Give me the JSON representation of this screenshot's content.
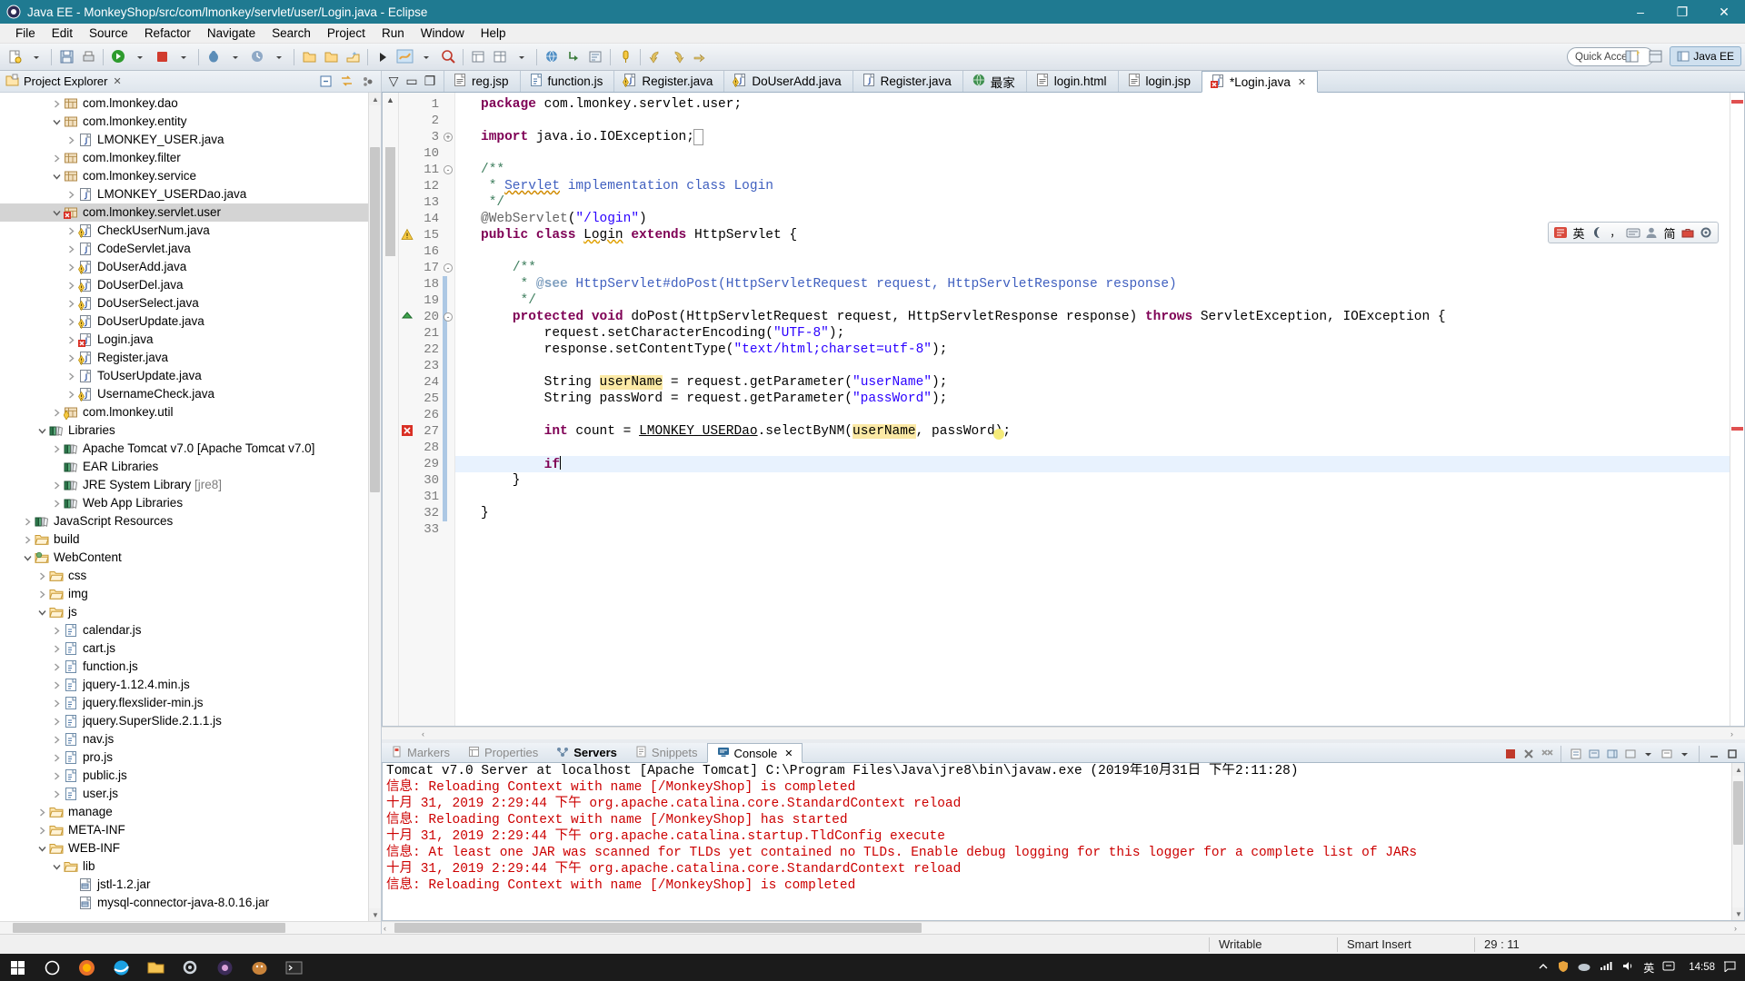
{
  "window": {
    "title": "Java EE - MonkeyShop/src/com/lmonkey/servlet/user/Login.java - Eclipse",
    "icon": "eclipse-icon",
    "minimize": "–",
    "maximize": "❐",
    "close": "✕"
  },
  "menubar": {
    "items": [
      "File",
      "Edit",
      "Source",
      "Refactor",
      "Navigate",
      "Search",
      "Project",
      "Run",
      "Window",
      "Help"
    ]
  },
  "toolbar": {
    "quick_access_placeholder": "Quick Access",
    "perspective_java_ee": "Java EE"
  },
  "explorer": {
    "title": "Project Explorer",
    "close_glyph": "✕",
    "tree": [
      {
        "depth": 3,
        "arrow": "collapsed",
        "icon": "package-icon",
        "label": "com.lmonkey.dao"
      },
      {
        "depth": 3,
        "arrow": "expanded",
        "icon": "package-icon",
        "label": "com.lmonkey.entity"
      },
      {
        "depth": 4,
        "arrow": "collapsed",
        "icon": "java-file-icon",
        "label": "LMONKEY_USER.java"
      },
      {
        "depth": 3,
        "arrow": "collapsed",
        "icon": "package-icon",
        "label": "com.lmonkey.filter"
      },
      {
        "depth": 3,
        "arrow": "expanded",
        "icon": "package-icon",
        "label": "com.lmonkey.service"
      },
      {
        "depth": 4,
        "arrow": "collapsed",
        "icon": "java-file-icon",
        "label": "LMONKEY_USERDao.java"
      },
      {
        "depth": 3,
        "arrow": "expanded",
        "icon": "package-error-icon",
        "label": "com.lmonkey.servlet.user",
        "selected": true
      },
      {
        "depth": 4,
        "arrow": "collapsed",
        "icon": "java-warn-icon",
        "label": "CheckUserNum.java"
      },
      {
        "depth": 4,
        "arrow": "collapsed",
        "icon": "java-file-icon",
        "label": "CodeServlet.java"
      },
      {
        "depth": 4,
        "arrow": "collapsed",
        "icon": "java-warn-icon",
        "label": "DoUserAdd.java"
      },
      {
        "depth": 4,
        "arrow": "collapsed",
        "icon": "java-warn-icon",
        "label": "DoUserDel.java"
      },
      {
        "depth": 4,
        "arrow": "collapsed",
        "icon": "java-warn-icon",
        "label": "DoUserSelect.java"
      },
      {
        "depth": 4,
        "arrow": "collapsed",
        "icon": "java-warn-icon",
        "label": "DoUserUpdate.java"
      },
      {
        "depth": 4,
        "arrow": "collapsed",
        "icon": "java-error-icon",
        "label": "Login.java"
      },
      {
        "depth": 4,
        "arrow": "collapsed",
        "icon": "java-warn-icon",
        "label": "Register.java"
      },
      {
        "depth": 4,
        "arrow": "collapsed",
        "icon": "java-file-icon",
        "label": "ToUserUpdate.java"
      },
      {
        "depth": 4,
        "arrow": "collapsed",
        "icon": "java-warn-icon",
        "label": "UsernameCheck.java"
      },
      {
        "depth": 3,
        "arrow": "collapsed",
        "icon": "package-warn-icon",
        "label": "com.lmonkey.util"
      },
      {
        "depth": 2,
        "arrow": "expanded",
        "icon": "library-icon",
        "label": "Libraries"
      },
      {
        "depth": 3,
        "arrow": "collapsed",
        "icon": "library-icon",
        "label": "Apache Tomcat v7.0 [Apache Tomcat v7.0]"
      },
      {
        "depth": 3,
        "arrow": "none",
        "icon": "library-icon",
        "label": "EAR Libraries"
      },
      {
        "depth": 3,
        "arrow": "collapsed",
        "icon": "library-icon",
        "label": "JRE System Library ",
        "dim": "[jre8]"
      },
      {
        "depth": 3,
        "arrow": "collapsed",
        "icon": "library-icon",
        "label": "Web App Libraries"
      },
      {
        "depth": 1,
        "arrow": "collapsed",
        "icon": "library-icon",
        "label": "JavaScript Resources"
      },
      {
        "depth": 1,
        "arrow": "collapsed",
        "icon": "folder-icon",
        "label": "build"
      },
      {
        "depth": 1,
        "arrow": "expanded",
        "icon": "folder-web-icon",
        "label": "WebContent"
      },
      {
        "depth": 2,
        "arrow": "collapsed",
        "icon": "folder-icon",
        "label": "css"
      },
      {
        "depth": 2,
        "arrow": "collapsed",
        "icon": "folder-icon",
        "label": "img"
      },
      {
        "depth": 2,
        "arrow": "expanded",
        "icon": "folder-icon",
        "label": "js"
      },
      {
        "depth": 3,
        "arrow": "collapsed",
        "icon": "js-file-icon",
        "label": "calendar.js"
      },
      {
        "depth": 3,
        "arrow": "collapsed",
        "icon": "js-file-icon",
        "label": "cart.js"
      },
      {
        "depth": 3,
        "arrow": "collapsed",
        "icon": "js-file-icon",
        "label": "function.js"
      },
      {
        "depth": 3,
        "arrow": "collapsed",
        "icon": "js-file-icon",
        "label": "jquery-1.12.4.min.js"
      },
      {
        "depth": 3,
        "arrow": "collapsed",
        "icon": "js-file-icon",
        "label": "jquery.flexslider-min.js"
      },
      {
        "depth": 3,
        "arrow": "collapsed",
        "icon": "js-file-icon",
        "label": "jquery.SuperSlide.2.1.1.js"
      },
      {
        "depth": 3,
        "arrow": "collapsed",
        "icon": "js-file-icon",
        "label": "nav.js"
      },
      {
        "depth": 3,
        "arrow": "collapsed",
        "icon": "js-file-icon",
        "label": "pro.js"
      },
      {
        "depth": 3,
        "arrow": "collapsed",
        "icon": "js-file-icon",
        "label": "public.js"
      },
      {
        "depth": 3,
        "arrow": "collapsed",
        "icon": "js-file-icon",
        "label": "user.js"
      },
      {
        "depth": 2,
        "arrow": "collapsed",
        "icon": "folder-icon",
        "label": "manage"
      },
      {
        "depth": 2,
        "arrow": "collapsed",
        "icon": "folder-icon",
        "label": "META-INF"
      },
      {
        "depth": 2,
        "arrow": "expanded",
        "icon": "folder-icon",
        "label": "WEB-INF"
      },
      {
        "depth": 3,
        "arrow": "expanded",
        "icon": "folder-icon",
        "label": "lib"
      },
      {
        "depth": 4,
        "arrow": "none",
        "icon": "jar-icon",
        "label": "jstl-1.2.jar"
      },
      {
        "depth": 4,
        "arrow": "none",
        "icon": "jar-icon",
        "label": "mysql-connector-java-8.0.16.jar"
      }
    ]
  },
  "editor": {
    "tabs": [
      {
        "label": "reg.jsp",
        "icon": "jsp-file-icon",
        "active": false
      },
      {
        "label": "function.js",
        "icon": "js-file-icon",
        "active": false
      },
      {
        "label": "Register.java",
        "icon": "java-warn-icon",
        "active": false
      },
      {
        "label": "DoUserAdd.java",
        "icon": "java-warn-icon",
        "active": false
      },
      {
        "label": "Register.java",
        "icon": "java-file-icon",
        "active": false
      },
      {
        "label": "最家",
        "icon": "web-globe-icon",
        "active": false
      },
      {
        "label": "login.html",
        "icon": "html-file-icon",
        "active": false
      },
      {
        "label": "login.jsp",
        "icon": "jsp-file-icon",
        "active": false
      },
      {
        "label": "*Login.java",
        "icon": "java-error-icon",
        "active": true,
        "close_glyph": "✕"
      }
    ],
    "lines": [
      {
        "n": "1",
        "fold": "",
        "marker": "",
        "text_html": "<span class=\"kw\">package</span> com.lmonkey.servlet.user;"
      },
      {
        "n": "2",
        "fold": "",
        "marker": "",
        "text_html": ""
      },
      {
        "n": "3",
        "fold": "+",
        "marker": "",
        "text_html": "<span class=\"kw\">import</span> java.io.IOException;<span style=\"outline:1px solid #9b9b9b;color:#9b9b9b\"> </span>"
      },
      {
        "n": "10",
        "fold": "",
        "marker": "",
        "text_html": ""
      },
      {
        "n": "11",
        "fold": "-",
        "marker": "",
        "text_html": "<span class=\"cmt\">/**</span>"
      },
      {
        "n": "12",
        "fold": "",
        "marker": "",
        "text_html": "<span class=\"cmt\"> * </span><span class=\"jd wavy-r\">Servlet</span><span class=\"jd\"> implementation class Login</span>"
      },
      {
        "n": "13",
        "fold": "",
        "marker": "",
        "text_html": "<span class=\"cmt\"> */</span>"
      },
      {
        "n": "14",
        "fold": "",
        "marker": "",
        "text_html": "<span class=\"ann\">@WebServlet</span>(<span class=\"str\">\"/login\"</span>)"
      },
      {
        "n": "15",
        "fold": "",
        "marker": "warn",
        "text_html": "<span class=\"kw\">public class</span> <span class=\"wavy\">Login</span> <span class=\"kw\">extends</span> HttpServlet {"
      },
      {
        "n": "16",
        "fold": "",
        "marker": "",
        "text_html": ""
      },
      {
        "n": "17",
        "fold": "-",
        "marker": "",
        "text_html": "    <span class=\"cmt\">/**</span>"
      },
      {
        "n": "18",
        "fold": "",
        "marker": "",
        "text_html": "     <span class=\"cmt\">* </span><span class=\"jdb\">@see</span><span class=\"jd\"> HttpServlet#doPost(HttpServletRequest request, HttpServletResponse response)</span>"
      },
      {
        "n": "19",
        "fold": "",
        "marker": "",
        "text_html": "     <span class=\"cmt\">*/</span>"
      },
      {
        "n": "20",
        "fold": "-",
        "marker": "ovr",
        "text_html": "    <span class=\"kw\">protected void</span> doPost(HttpServletRequest request, HttpServletResponse response) <span class=\"kw\">throws</span> ServletException, IOException {"
      },
      {
        "n": "21",
        "fold": "",
        "marker": "",
        "text_html": "        request.setCharacterEncoding(<span class=\"str\">\"UTF-8\"</span>);"
      },
      {
        "n": "22",
        "fold": "",
        "marker": "",
        "text_html": "        response.setContentType(<span class=\"str\">\"text/html;charset=utf-8\"</span>);"
      },
      {
        "n": "23",
        "fold": "",
        "marker": "",
        "text_html": ""
      },
      {
        "n": "24",
        "fold": "",
        "marker": "",
        "text_html": "        String <span class=\"hl\">userName</span> = request.getParameter(<span class=\"str\">\"userName\"</span>);"
      },
      {
        "n": "25",
        "fold": "",
        "marker": "",
        "text_html": "        String passWord = request.getParameter(<span class=\"str\">\"passWord\"</span>);"
      },
      {
        "n": "26",
        "fold": "",
        "marker": "",
        "text_html": ""
      },
      {
        "n": "27",
        "fold": "",
        "marker": "err",
        "text_html": "        <span class=\"kw\">int</span> count = <span class=\"underline\">LMONKEY_USERDao</span>.selectByNM(<span class=\"hl\">userName</span>, passWord);"
      },
      {
        "n": "28",
        "fold": "",
        "marker": "",
        "text_html": ""
      },
      {
        "n": "29",
        "fold": "",
        "marker": "",
        "text_html": "        <span class=\"kw\">if</span><span class=\"caret\"></span>",
        "current": true
      },
      {
        "n": "30",
        "fold": "",
        "marker": "",
        "text_html": "    }"
      },
      {
        "n": "31",
        "fold": "",
        "marker": "",
        "text_html": ""
      },
      {
        "n": "32",
        "fold": "",
        "marker": "",
        "text_html": "}"
      },
      {
        "n": "33",
        "fold": "",
        "marker": "",
        "text_html": ""
      }
    ]
  },
  "ime": {
    "items": [
      "ime-logo-icon",
      "英",
      "moon-icon",
      "comma-icon",
      "keyboard-icon",
      "person-icon",
      "简",
      "toolbox-icon",
      "gear-icon"
    ]
  },
  "console": {
    "tabs": [
      {
        "label": "Markers",
        "icon": "markers-icon",
        "active": false,
        "bold": false
      },
      {
        "label": "Properties",
        "icon": "properties-icon",
        "active": false,
        "bold": false
      },
      {
        "label": "Servers",
        "icon": "servers-icon",
        "active": false,
        "bold": true
      },
      {
        "label": "Snippets",
        "icon": "snippets-icon",
        "active": false,
        "bold": false
      },
      {
        "label": "Console",
        "icon": "console-icon",
        "active": true,
        "bold": false,
        "close_glyph": "✕"
      }
    ],
    "header": "Tomcat v7.0 Server at localhost [Apache Tomcat] C:\\Program Files\\Java\\jre8\\bin\\javaw.exe (2019年10月31日 下午2:11:28)",
    "lines": [
      {
        "color": "red",
        "text": "信息: Reloading Context with name [/MonkeyShop] is completed"
      },
      {
        "color": "red",
        "text": "十月 31, 2019 2:29:44 下午 org.apache.catalina.core.StandardContext reload"
      },
      {
        "color": "red",
        "text": "信息: Reloading Context with name [/MonkeyShop] has started"
      },
      {
        "color": "red",
        "text": "十月 31, 2019 2:29:44 下午 org.apache.catalina.startup.TldConfig execute"
      },
      {
        "color": "red",
        "text": "信息: At least one JAR was scanned for TLDs yet contained no TLDs. Enable debug logging for this logger for a complete list of JARs"
      },
      {
        "color": "red",
        "text": "十月 31, 2019 2:29:44 下午 org.apache.catalina.core.StandardContext reload"
      },
      {
        "color": "red",
        "text": "信息: Reloading Context with name [/MonkeyShop] is completed"
      }
    ]
  },
  "statusbar": {
    "writable": "Writable",
    "insert_mode": "Smart Insert",
    "position": "29 : 11"
  },
  "taskbar": {
    "clock_time": "14:58",
    "tray_lang": "英"
  },
  "colors": {
    "title_bg": "#1f7a91",
    "accent": "#2a00ff",
    "keyword": "#7f0055",
    "comment": "#3f7f5f",
    "console_red": "#cc0000",
    "highlight": "#fbe9a5"
  }
}
